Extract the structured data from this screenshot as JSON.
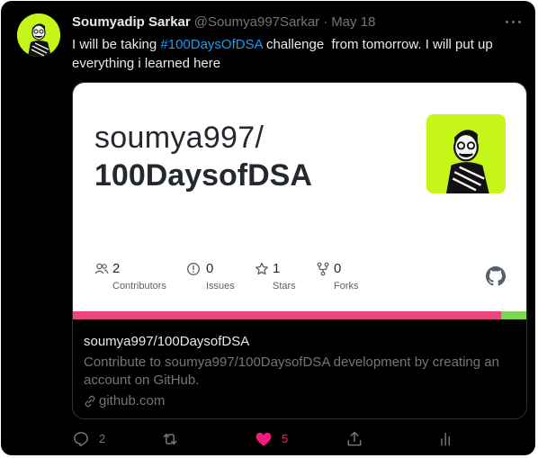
{
  "tweet": {
    "display_name": "Soumyadip Sarkar",
    "handle": "@Soumya997Sarkar",
    "separator": "·",
    "date": "May 18",
    "text_before": "I will be taking ",
    "hashtag": "#100DaysOfDSA",
    "text_after": " challenge  from tomorrow. I will put up everything i learned here"
  },
  "card": {
    "owner": "soumya997/",
    "repo": "100DaysofDSA",
    "stats": [
      {
        "icon": "contributors-icon",
        "value": "2",
        "label": "Contributors"
      },
      {
        "icon": "issues-icon",
        "value": "0",
        "label": "Issues"
      },
      {
        "icon": "star-icon",
        "value": "1",
        "label": "Stars"
      },
      {
        "icon": "fork-icon",
        "value": "0",
        "label": "Forks"
      }
    ],
    "language_bar": [
      {
        "color": "#e8467c",
        "share": 0.945
      },
      {
        "color": "#7bd652",
        "share": 0.055
      }
    ],
    "title": "soumya997/100DaysofDSA",
    "description": "Contribute to soumya997/100DaysofDSA development by creating an account on GitHub.",
    "domain": "github.com"
  },
  "actions": {
    "reply_count": "2",
    "retweet_count": "",
    "like_count": "5"
  },
  "colors": {
    "background": "#000000",
    "accent": "#1d9bf0",
    "like": "#f91880",
    "avatar_bg": "#c6f51a"
  }
}
